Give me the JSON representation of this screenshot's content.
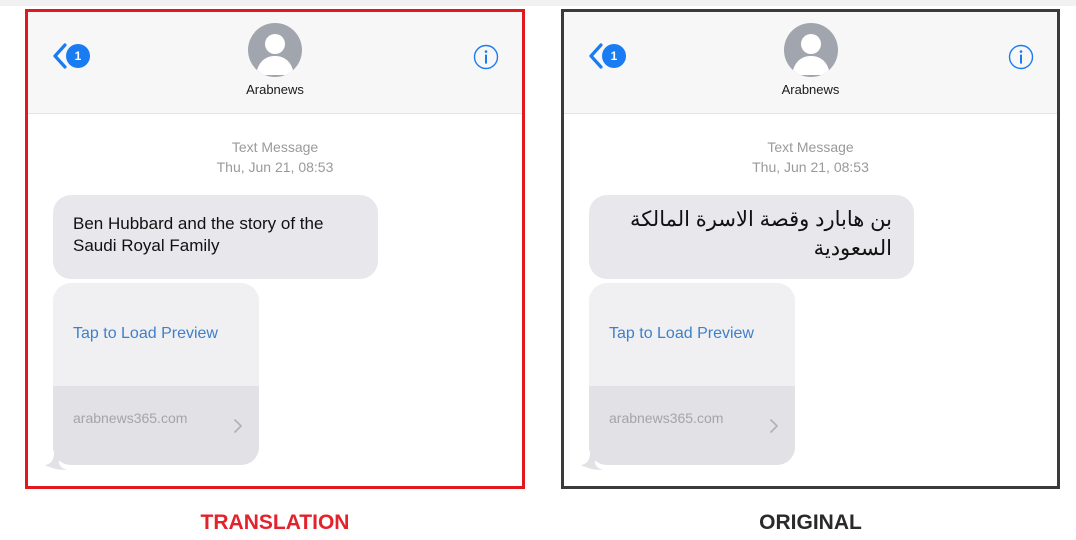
{
  "panels": [
    {
      "caption": "TRANSLATION",
      "header": {
        "badge_count": "1",
        "contact_name": "Arabnews"
      },
      "meta": {
        "type": "Text Message",
        "timestamp": "Thu, Jun 21, 08:53"
      },
      "message": "Ben Hubbard and the story of the Saudi Royal Family",
      "preview": {
        "link_text": "Tap to Load Preview",
        "domain": "arabnews365.com"
      }
    },
    {
      "caption": "ORIGINAL",
      "header": {
        "badge_count": "1",
        "contact_name": "Arabnews"
      },
      "meta": {
        "type": "Text Message",
        "timestamp": "Thu, Jun 21, 08:53"
      },
      "message": "بن هابارد وقصة الاسرة المالكة السعودية",
      "preview": {
        "link_text": "Tap to Load Preview",
        "domain": "arabnews365.com"
      }
    }
  ],
  "icons": {
    "back": "chevron-left-icon",
    "info": "info-circle-icon",
    "avatar": "person-silhouette-icon",
    "preview_arrow": "chevron-right-icon"
  },
  "colors": {
    "translation_border": "#e01820",
    "original_border": "#3a3a3a",
    "ios_blue": "#1a7cf2",
    "bubble_gray": "#e7e7ec"
  }
}
